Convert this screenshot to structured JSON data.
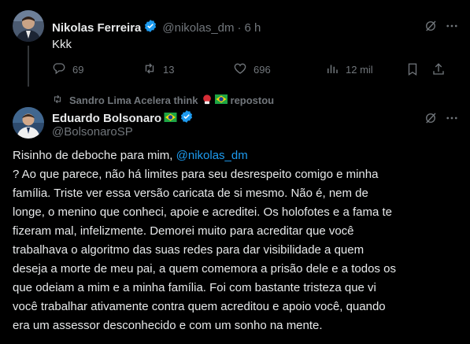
{
  "tweet1": {
    "name": "Nikolas Ferreira",
    "handle": "@nikolas_dm",
    "separator": "·",
    "time": "6 h",
    "text": "Kkk",
    "actions": {
      "replies": "69",
      "retweets": "13",
      "likes": "696",
      "views": "12 mil"
    }
  },
  "repost": {
    "text": "Sandro Lima Acelera think",
    "suffix": "repostou"
  },
  "tweet2": {
    "name": "Eduardo Bolsonaro",
    "handle": "@BolsonaroSP",
    "text_before_link": "Risinho de deboche para mim, ",
    "mention": "@nikolas_dm",
    "text_after_link": "\n? Ao que parece, não há limites para seu desrespeito comigo e minha\nfamília. Triste ver essa versão caricata de si mesmo. Não é, nem de\nlonge, o menino que conheci, apoie e acreditei. Os holofotes e a fama te\nfizeram mal, infelizmente. Demorei muito para acreditar que você\ntrabalhava o algoritmo das suas redes para dar visibilidade a quem\ndeseja a morte de meu pai, a quem comemora a prisão dele e a todos os\nque odeiam a mim e a minha família. Foi com bastante tristeza que vi\nvocê trabalhar ativamente contra quem acreditou e apoio você, quando\nera um assessor desconhecido e com um sonho na mente."
  },
  "icons": {
    "verified": "verified-badge-icon",
    "more": "more-icon",
    "grok": "grok-icon",
    "reply": "reply-icon",
    "retweet": "retweet-icon",
    "like": "heart-icon",
    "views": "views-icon",
    "bookmark": "bookmark-icon",
    "share": "share-icon"
  },
  "colors": {
    "background": "#000000",
    "text": "#e7e9ea",
    "muted": "#71767b",
    "accent": "#1d9bf0"
  }
}
